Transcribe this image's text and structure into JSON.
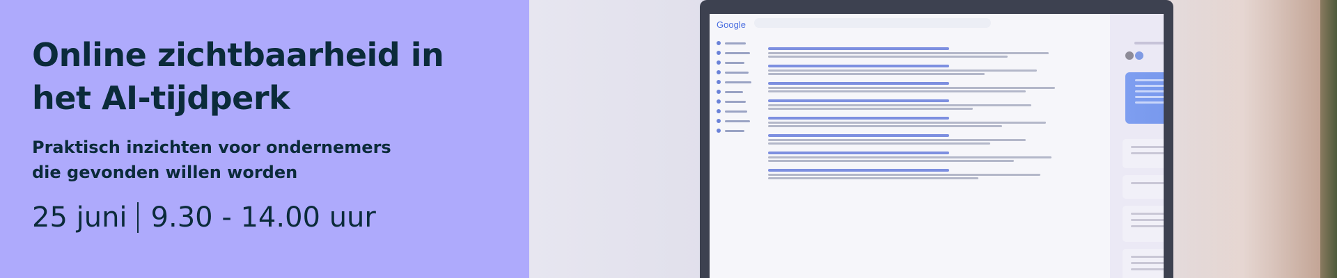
{
  "promo": {
    "title_line1": "Online zichtbaarheid in",
    "title_line2": "het AI-tijdperk",
    "subtitle_line1": "Praktisch inzichten voor ondernemers",
    "subtitle_line2": "die gevonden willen worden",
    "date": "25 juni",
    "time": "9.30 - 14.00 uur"
  },
  "photo": {
    "search_logo": "Google"
  },
  "colors": {
    "panel_background": "#aeaafc",
    "text": "#0b2b3a",
    "ai_bubble": "#7e9ef0"
  }
}
